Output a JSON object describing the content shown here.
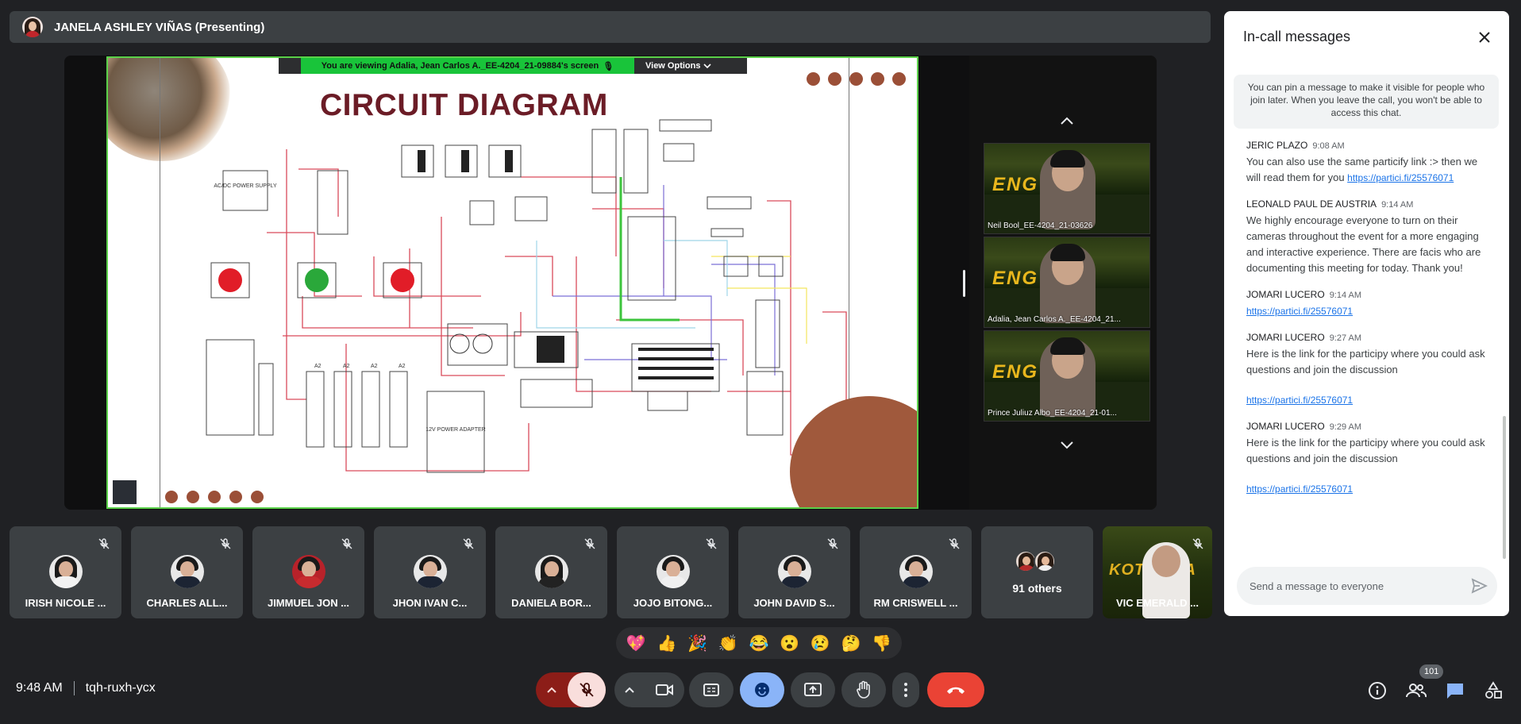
{
  "presenter": {
    "name": "JANELA ASHLEY VIÑAS (Presenting)"
  },
  "screen_share": {
    "viewing_text": "You are viewing  Adalia, Jean Carlos A._EE-4204_21-09884's screen",
    "view_options_label": "View Options",
    "slide_title": "CIRCUIT DIAGRAM",
    "labels": {
      "ac_dc": "AC/DC POWER SUPPLY",
      "adapter": "12V POWER ADAPTER",
      "a2": "A2"
    }
  },
  "stage_videos": [
    {
      "name": "Neil Bool_EE-4204_21-03626"
    },
    {
      "name": "Adalia, Jean Carlos A._EE-4204_21..."
    },
    {
      "name": "Prince Juliuz Albo_EE-4204_21-01..."
    }
  ],
  "participants": [
    {
      "name": "IRISH NICOLE ..."
    },
    {
      "name": "CHARLES ALL..."
    },
    {
      "name": "JIMMUEL JON ..."
    },
    {
      "name": "JHON IVAN C..."
    },
    {
      "name": "DANIELA BOR..."
    },
    {
      "name": "JOJO BITONG..."
    },
    {
      "name": "JOHN DAVID S..."
    },
    {
      "name": "RM CRISWELL ..."
    }
  ],
  "others": {
    "label": "91 others"
  },
  "video_participant": {
    "name": "VIC EMERALD ..."
  },
  "reactions": [
    "💖",
    "👍",
    "🎉",
    "👏",
    "😂",
    "😮",
    "😢",
    "🤔",
    "👎"
  ],
  "meeting": {
    "time": "9:48 AM",
    "code": "tqh-ruxh-ycx"
  },
  "people_count": "101",
  "chat": {
    "title": "In-call messages",
    "pin_note": "You can pin a message to make it visible for people who join later. When you leave the call, you won't be able to access this chat.",
    "messages": [
      {
        "sender": "JERIC PLAZO",
        "time": "9:08 AM",
        "body": "You can also use the same particify link :> then we will read them for you ",
        "link": "https://partici.fi/25576071"
      },
      {
        "sender": "LEONALD PAUL DE AUSTRIA",
        "time": "9:14 AM",
        "body": "We highly encourage everyone to turn on their cameras throughout the event for a more engaging and interactive experience.  There are facis who are documenting this meeting for today. Thank you!",
        "link": ""
      },
      {
        "sender": "JOMARI LUCERO",
        "time": "9:14 AM",
        "body": "",
        "link": "https://partici.fi/25576071"
      },
      {
        "sender": "JOMARI LUCERO",
        "time": "9:27 AM",
        "body": "Here is the link for the participy where you could ask questions and join the discussion",
        "link": "https://partici.fi/25576071"
      },
      {
        "sender": "JOMARI LUCERO",
        "time": "9:29 AM",
        "body": "Here is the link for the participy where you could ask questions and join the discussion",
        "link": "https://partici.fi/25576071"
      }
    ],
    "input_placeholder": "Send a message to everyone"
  },
  "colors": {
    "accent": "#8ab4f8",
    "end_call": "#ea4335",
    "mic_off": "#f9dedc",
    "viewing_banner": "#19c43a"
  }
}
